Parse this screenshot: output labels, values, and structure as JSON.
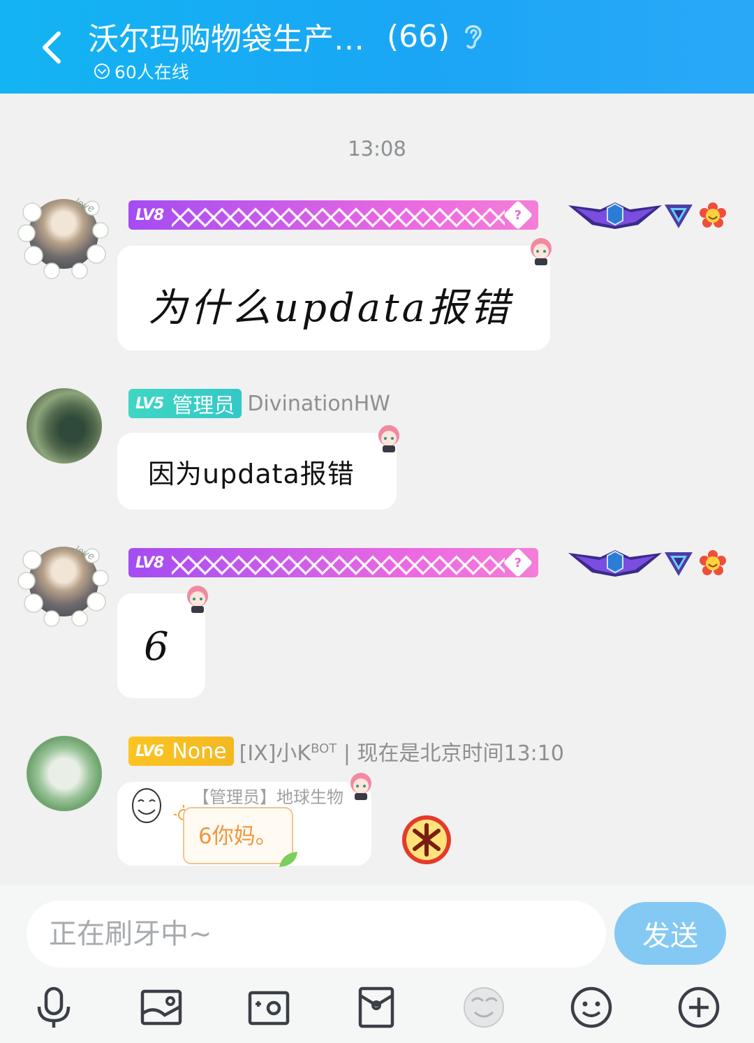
{
  "header": {
    "title": "沃尔玛购物袋生产…",
    "member_count": "(66)",
    "online": "60人在线",
    "background": "#13b4f2"
  },
  "chat": {
    "timestamp": "13:08",
    "messages": [
      {
        "level": "LV8",
        "text": "为什么updata报错"
      },
      {
        "level": "LV5",
        "role_title": "管理员",
        "nickname": "DivinationHW",
        "text": "因为updata报错"
      },
      {
        "level": "LV8",
        "text": "6"
      },
      {
        "level": "LV6",
        "role_title": "None",
        "nickname": "[IX]小K",
        "nickname_sup": "BOT",
        "nickname_rest": "| 现在是北京时间13:10",
        "reply_author": "【管理员】地球生物",
        "reply_text": "6你妈。"
      }
    ]
  },
  "input": {
    "placeholder": "正在刷牙中~",
    "send_label": "发送",
    "send_color": "#84c9f4"
  },
  "toolbar": {
    "icons": [
      "microphone-icon",
      "image-icon",
      "camera-icon",
      "red-packet-icon",
      "avatar-face-icon",
      "emoji-icon",
      "plus-icon"
    ]
  }
}
